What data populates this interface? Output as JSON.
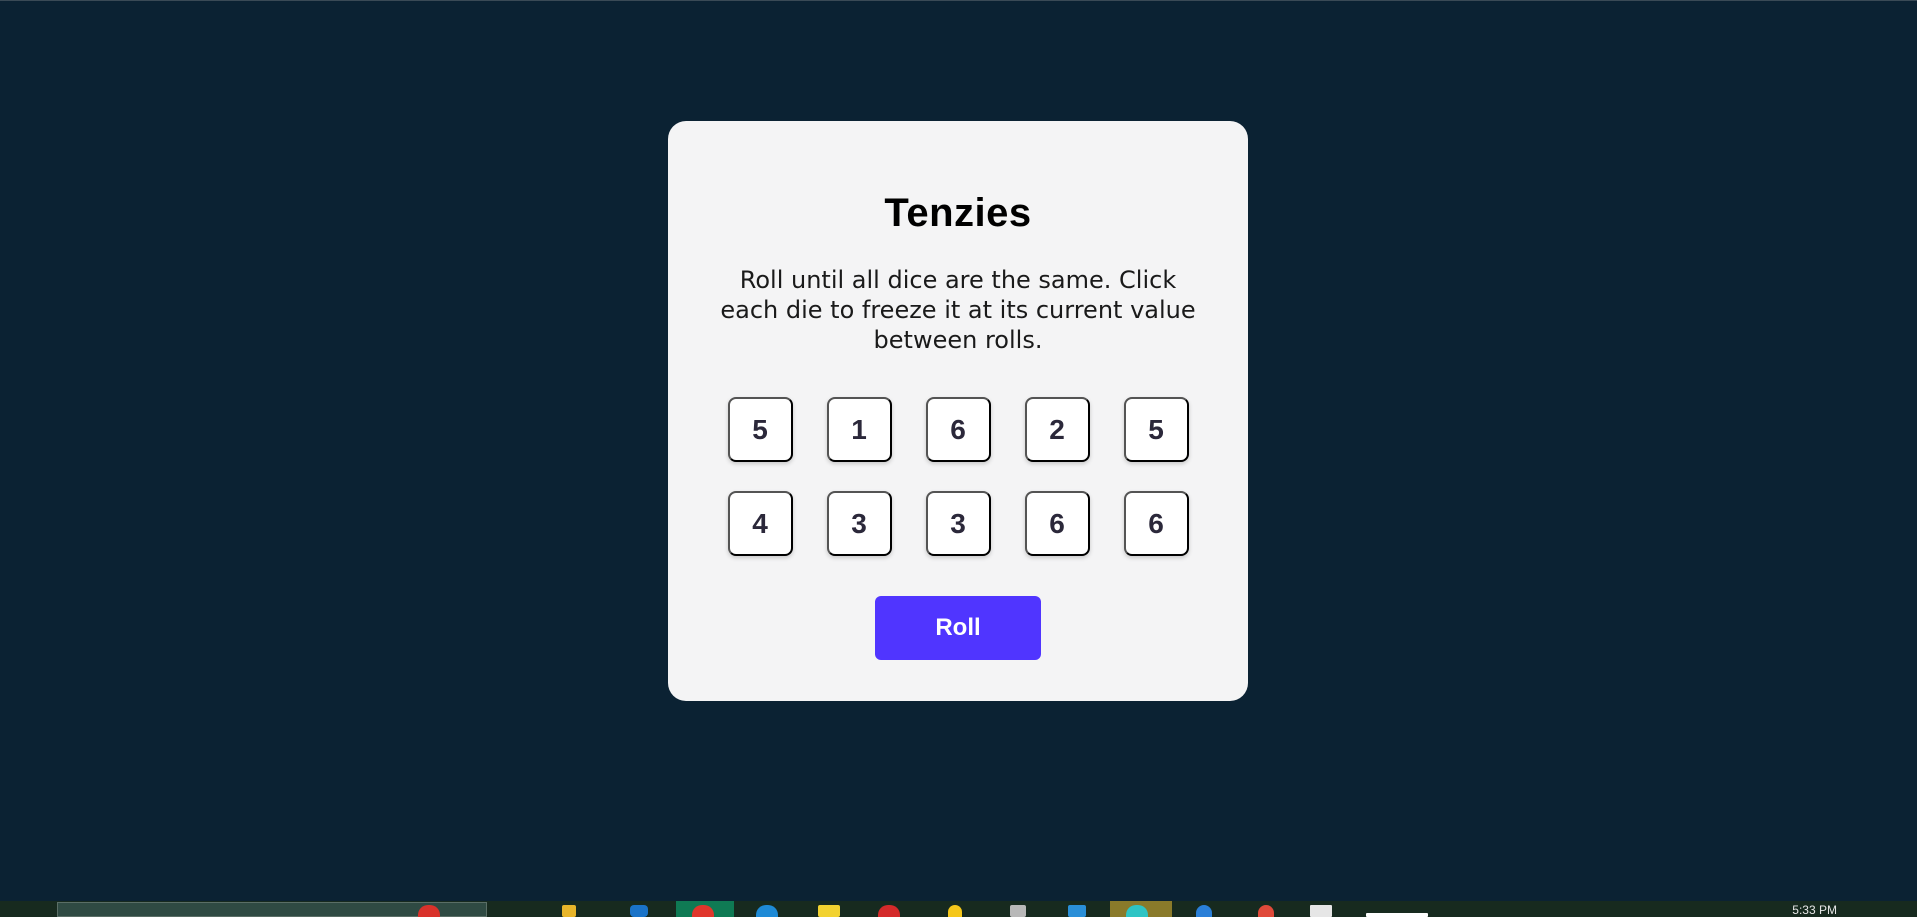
{
  "app": {
    "title": "Tenzies",
    "instructions": "Roll until all dice are the same. Click each die to freeze it at its current value between rolls."
  },
  "dice": [
    "5",
    "1",
    "6",
    "2",
    "5",
    "4",
    "3",
    "3",
    "6",
    "6"
  ],
  "roll_button": {
    "label": "Roll"
  },
  "colors": {
    "background": "#0b2233",
    "card": "#f4f4f5",
    "die_face": "#ffffff",
    "die_text": "#2b283a",
    "accent": "#5035ff"
  },
  "taskbar": {
    "clock": "5:33 PM",
    "icons": [
      "app-icon-red",
      "folder-icon",
      "store-icon",
      "chrome-icon",
      "edge-icon",
      "notes-icon",
      "opera-icon",
      "drive-icon",
      "files-icon",
      "vscode-icon",
      "cursor-icon",
      "ide-icon",
      "git-icon",
      "editor-icon",
      "notepad-icon"
    ]
  }
}
